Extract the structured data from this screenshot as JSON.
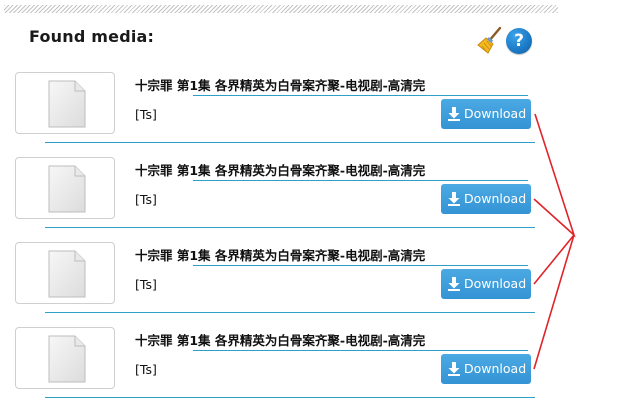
{
  "panel": {
    "title": "Found media:"
  },
  "items": [
    {
      "title": "十宗罪 第1集 各界精英为白骨案齐聚-电视剧-高清完",
      "format": "[Ts]",
      "download_label": "Download"
    },
    {
      "title": "十宗罪 第1集 各界精英为白骨案齐聚-电视剧-高清完",
      "format": "[Ts]",
      "download_label": "Download"
    },
    {
      "title": "十宗罪 第1集 各界精英为白骨案齐聚-电视剧-高清完",
      "format": "[Ts]",
      "download_label": "Download"
    },
    {
      "title": "十宗罪 第1集 各界精英为白骨案齐聚-电视剧-高清完",
      "format": "[Ts]",
      "download_label": "Download"
    }
  ],
  "icons": {
    "clear": "broom-icon",
    "help": "help-icon",
    "thumbnail": "file-icon",
    "download": "download-arrow-icon"
  },
  "help_glyph": "?",
  "colors": {
    "button": "#3d9ddb",
    "rule": "#2e9fc7",
    "annotation": "#e0242b"
  }
}
